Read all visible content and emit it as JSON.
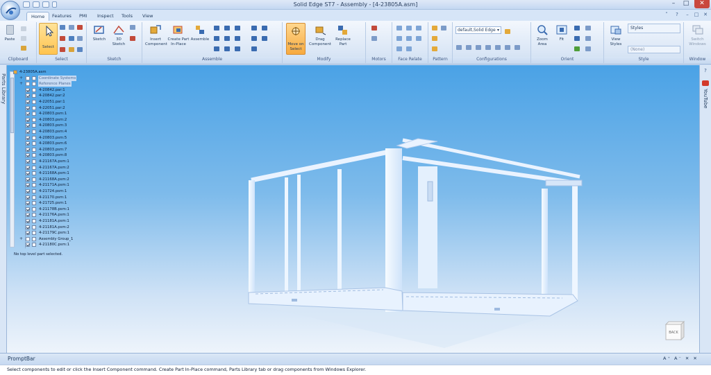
{
  "window": {
    "title": "Solid Edge ST7 - Assembly - [4-23805A.asm]"
  },
  "tabs": [
    {
      "label": "Home",
      "active": true
    },
    {
      "label": "Features",
      "active": false
    },
    {
      "label": "PMI",
      "active": false
    },
    {
      "label": "Inspect",
      "active": false
    },
    {
      "label": "Tools",
      "active": false
    },
    {
      "label": "View",
      "active": false
    }
  ],
  "ribbon": {
    "groups": {
      "clipboard": "Clipboard",
      "select": "Select",
      "sketch": "Sketch",
      "assemble": "Assemble",
      "modify": "Modify",
      "motors": "Motors",
      "face_relate": "Face Relate",
      "pattern": "Pattern",
      "configurations": "Configurations",
      "orient": "Orient",
      "style": "Style",
      "window": "Window"
    },
    "buttons": {
      "paste": "Paste",
      "select": "Select",
      "sketch": "Sketch",
      "sketch3d_1": "3D",
      "sketch3d_2": "Sketch",
      "insert_1": "Insert",
      "insert_2": "Component",
      "create_part_1": "Create Part",
      "create_part_2": "In-Place",
      "assemble": "Assemble",
      "move_on_1": "Move on",
      "move_on_2": "Select",
      "drag_1": "Drag",
      "drag_2": "Component",
      "replace_1": "Replace",
      "replace_2": "Part",
      "zoom_1": "Zoom",
      "zoom_2": "Area",
      "fit": "Fit",
      "view_styles_1": "View",
      "view_styles_2": "Styles",
      "switch_1": "Switch",
      "switch_2": "Windows"
    },
    "config_value": "default,Solid Edge",
    "styles_label": "Styles",
    "style_value": "(None)"
  },
  "sidebars": {
    "parts_library": "Parts Library",
    "youtube": "YouTube"
  },
  "tree": {
    "root": "4-23805A.asm",
    "items": [
      {
        "name": "Coordinate Systems",
        "checked": false,
        "hl": true
      },
      {
        "name": "Reference Planes",
        "checked": false,
        "hl": true
      },
      {
        "name": "4-20842.par:1",
        "checked": true,
        "hl": false
      },
      {
        "name": "4-20842.par:2",
        "checked": true,
        "hl": false
      },
      {
        "name": "4-22051.par:1",
        "checked": true,
        "hl": false
      },
      {
        "name": "4-22051.par:2",
        "checked": true,
        "hl": false
      },
      {
        "name": "4-20803.psm:1",
        "checked": true,
        "hl": false
      },
      {
        "name": "4-20803.psm:2",
        "checked": true,
        "hl": false
      },
      {
        "name": "4-20803.psm:3",
        "checked": true,
        "hl": false
      },
      {
        "name": "4-20803.psm:4",
        "checked": true,
        "hl": false
      },
      {
        "name": "4-20803.psm:5",
        "checked": true,
        "hl": false
      },
      {
        "name": "4-20803.psm:6",
        "checked": true,
        "hl": false
      },
      {
        "name": "4-20803.psm:7",
        "checked": true,
        "hl": false
      },
      {
        "name": "4-20803.psm:8",
        "checked": true,
        "hl": false
      },
      {
        "name": "4-21167A.psm:1",
        "checked": true,
        "hl": false
      },
      {
        "name": "4-21167A.psm:2",
        "checked": true,
        "hl": false
      },
      {
        "name": "4-21168A.psm:1",
        "checked": true,
        "hl": false
      },
      {
        "name": "4-21168A.psm:2",
        "checked": true,
        "hl": false
      },
      {
        "name": "4-21171A.psm:1",
        "checked": true,
        "hl": false
      },
      {
        "name": "4-21724.psm:1",
        "checked": true,
        "hl": false
      },
      {
        "name": "4-21170.psm:1",
        "checked": true,
        "hl": false
      },
      {
        "name": "4-21725.psm:1",
        "checked": true,
        "hl": false
      },
      {
        "name": "4-21178B.psm:1",
        "checked": true,
        "hl": false
      },
      {
        "name": "4-21176A.psm:1",
        "checked": true,
        "hl": false
      },
      {
        "name": "4-21181A.psm:1",
        "checked": true,
        "hl": false
      },
      {
        "name": "4-21181A.psm:2",
        "checked": true,
        "hl": false
      },
      {
        "name": "4-21179C.psm:1",
        "checked": true,
        "hl": false
      },
      {
        "name": "Assembly Group_1",
        "checked": false,
        "hl": false
      },
      {
        "name": "4-21180C.psm:1",
        "checked": true,
        "hl": false
      }
    ],
    "status": "No top level part selected."
  },
  "viewcube": {
    "label": "BACK"
  },
  "promptbar": {
    "title": "PromptBar",
    "tools": "A⁺ A⁻ ✕ ✕",
    "message": "Select components to edit or click the Insert Component command. Create Part In-Place command, Parts Library tab or drag components from Windows Explorer."
  },
  "colors": {
    "accent": "#ffc44f",
    "viewport_top": "#4aa2e6",
    "viewport_bottom": "#eef4fb",
    "model": "#eaf3ff"
  }
}
